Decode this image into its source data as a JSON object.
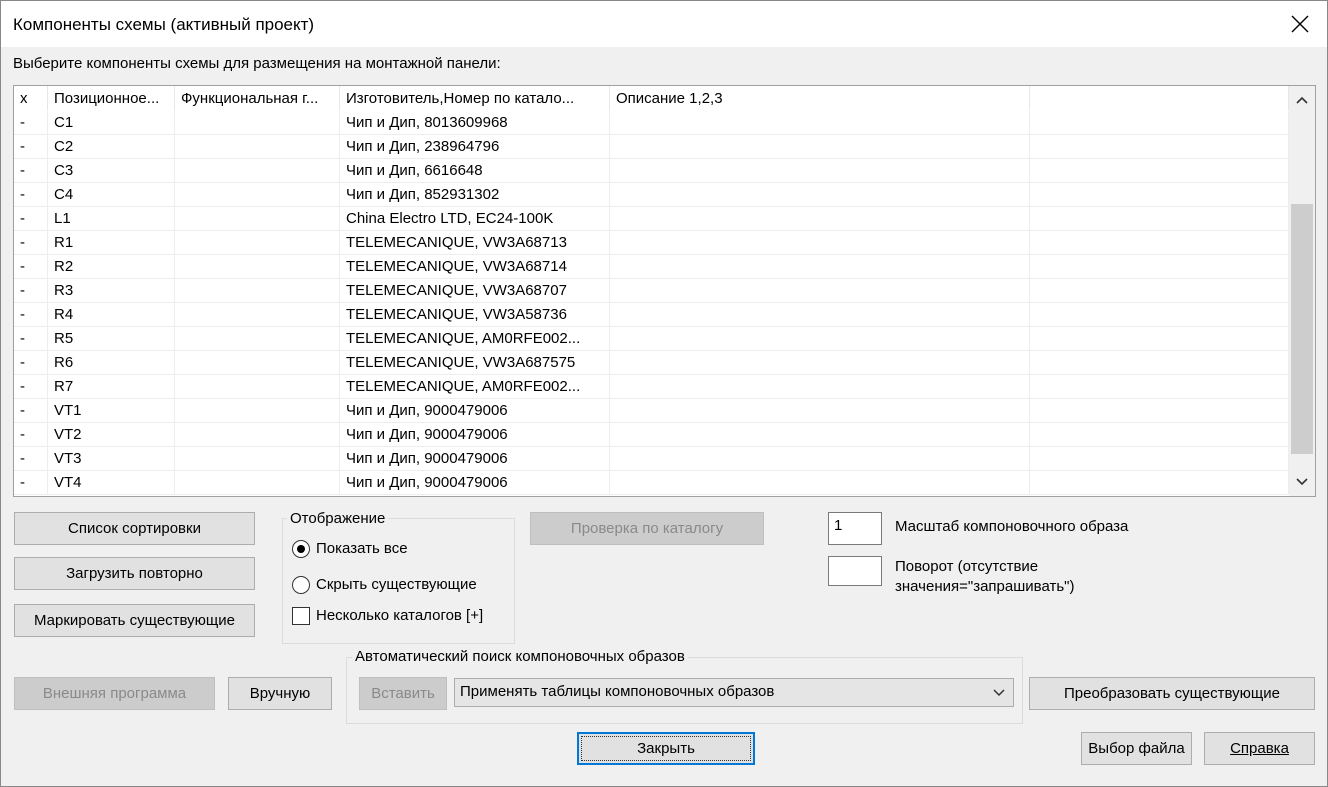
{
  "window": {
    "title": "Компоненты схемы (активный проект)"
  },
  "instruction": "Выберите компоненты схемы для размещения на монтажной панели:",
  "table": {
    "columns": [
      "x",
      "Позиционное...",
      "Функциональная г...",
      "Изготовитель,Номер по катало...",
      "Описание 1,2,3",
      ""
    ],
    "rows": [
      [
        "-",
        "C1",
        "",
        "Чип и Дип, 8013609968",
        "",
        ""
      ],
      [
        "-",
        "C2",
        "",
        "Чип и Дип, 238964796",
        "",
        ""
      ],
      [
        "-",
        "C3",
        "",
        "Чип и Дип, 6616648",
        "",
        ""
      ],
      [
        "-",
        "C4",
        "",
        "Чип и Дип, 852931302",
        "",
        ""
      ],
      [
        "-",
        "L1",
        "",
        "China Electro LTD, EC24-100K",
        "",
        ""
      ],
      [
        "-",
        "R1",
        "",
        "TELEMECANIQUE, VW3A68713",
        "",
        ""
      ],
      [
        "-",
        "R2",
        "",
        "TELEMECANIQUE, VW3A68714",
        "",
        ""
      ],
      [
        "-",
        "R3",
        "",
        "TELEMECANIQUE, VW3A68707",
        "",
        ""
      ],
      [
        "-",
        "R4",
        "",
        "TELEMECANIQUE, VW3A58736",
        "",
        ""
      ],
      [
        "-",
        "R5",
        "",
        "TELEMECANIQUE, AM0RFE002...",
        "",
        ""
      ],
      [
        "-",
        "R6",
        "",
        "TELEMECANIQUE, VW3A687575",
        "",
        ""
      ],
      [
        "-",
        "R7",
        "",
        "TELEMECANIQUE, AM0RFE002...",
        "",
        ""
      ],
      [
        "-",
        "VT1",
        "",
        "Чип и Дип, 9000479006",
        "",
        ""
      ],
      [
        "-",
        "VT2",
        "",
        "Чип и Дип, 9000479006",
        "",
        ""
      ],
      [
        "-",
        "VT3",
        "",
        "Чип и Дип, 9000479006",
        "",
        ""
      ],
      [
        "-",
        "VT4",
        "",
        "Чип и Дип, 9000479006",
        "",
        ""
      ]
    ]
  },
  "buttons": {
    "sort_list": "Список сортировки",
    "reload": "Загрузить повторно",
    "mark_existing": "Маркировать существующие",
    "catalog_check": "Проверка по каталогу",
    "external_program": "Внешняя программа",
    "manual": "Вручную",
    "insert": "Вставить",
    "convert_existing": "Преобразовать существующие",
    "close": "Закрыть",
    "file_select": "Выбор файла",
    "help": "Справка"
  },
  "display_group": {
    "legend": "Отображение",
    "show_all": "Показать все",
    "hide_existing": "Скрыть существующие",
    "multi_catalogs": "Несколько каталогов [+]",
    "selected": "show_all"
  },
  "scale": {
    "value": "1",
    "label": "Масштаб компоновочного образа"
  },
  "rotation": {
    "value": "",
    "label_line1": "Поворот (отсутствие",
    "label_line2": "значения=\"запрашивать\")"
  },
  "auto_search": {
    "legend": "Автоматический поиск компоновочных образов",
    "selected": "Применять таблицы компоновочных образов"
  },
  "icons": {
    "close": "close-icon",
    "scroll_up": "chevron-up-icon",
    "scroll_down": "chevron-down-icon",
    "dropdown": "chevron-down-icon"
  }
}
